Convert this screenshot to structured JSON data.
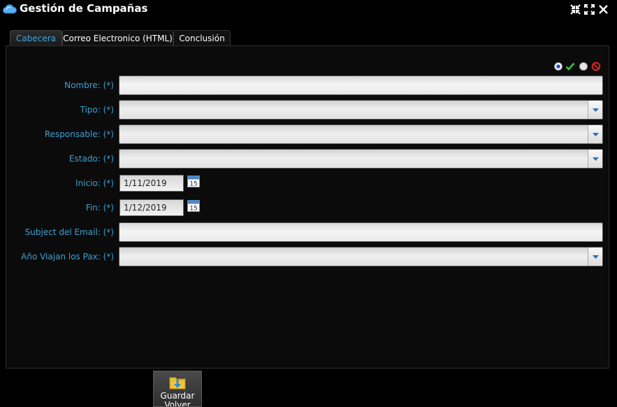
{
  "window": {
    "title": "Gestión de Campañas",
    "app_icon": "cloud-icon",
    "controls": [
      "restore-icon",
      "maximize-icon",
      "close-icon"
    ]
  },
  "tabs": [
    {
      "label": "Cabecera",
      "active": true
    },
    {
      "label": "Correo Electronico (HTML)",
      "active": false
    },
    {
      "label": "Conclusión",
      "active": false
    }
  ],
  "status_icons": [
    "radio-selected-icon",
    "check-icon",
    "circle-icon",
    "cancel-icon"
  ],
  "form": {
    "nombre": {
      "label": "Nombre: (*)",
      "value": ""
    },
    "tipo": {
      "label": "Tipo: (*)",
      "value": ""
    },
    "responsable": {
      "label": "Responsable: (*)",
      "value": ""
    },
    "estado": {
      "label": "Estado: (*)",
      "value": ""
    },
    "inicio": {
      "label": "Inicio: (*)",
      "value": "1/11/2019"
    },
    "fin": {
      "label": "Fin: (*)",
      "value": "1/12/2019"
    },
    "subject": {
      "label": "Subject del Email: (*)",
      "value": ""
    },
    "anio": {
      "label": "Año Viajan los Pax: (*)",
      "value": ""
    }
  },
  "calendar_icon_day": "15",
  "save_button": {
    "label": "Guardar Volver"
  },
  "colors": {
    "label_blue": "#3e9fd0",
    "active_tab": "#3ea6da",
    "background": "#000000"
  }
}
